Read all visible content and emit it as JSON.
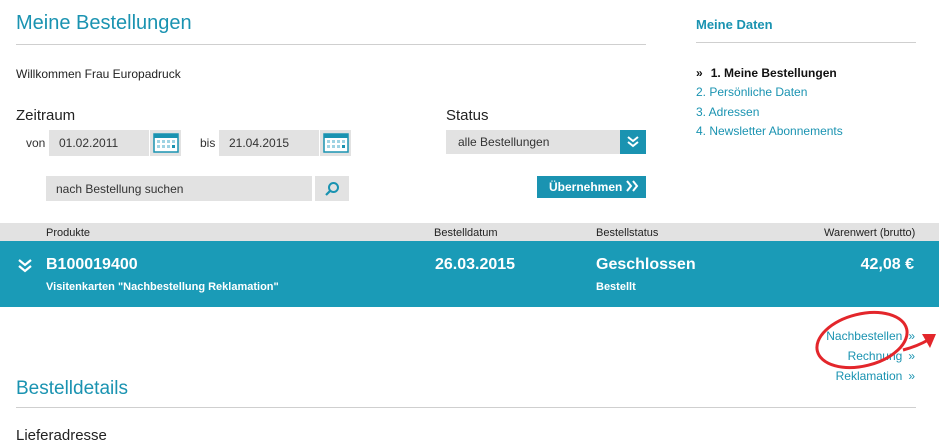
{
  "page_title": "Meine Bestellungen",
  "welcome_text": "Willkommen Frau Europadruck",
  "filter": {
    "period_label": "Zeitraum",
    "from_label": "von",
    "from_value": "01.02.2011",
    "to_label": "bis",
    "to_value": "21.04.2015",
    "status_label": "Status",
    "status_value": "alle Bestellungen",
    "search_placeholder": "nach Bestellung suchen",
    "submit_label": "Übernehmen"
  },
  "sidebar": {
    "title": "Meine Daten",
    "items": [
      {
        "label": "1. Meine Bestellungen",
        "active": true
      },
      {
        "label": "2. Persönliche Daten",
        "active": false
      },
      {
        "label": "3. Adressen",
        "active": false
      },
      {
        "label": "4. Newsletter Abonnements",
        "active": false
      }
    ]
  },
  "table": {
    "headers": {
      "products": "Produkte",
      "date": "Bestelldatum",
      "status": "Bestellstatus",
      "value": "Warenwert (brutto)"
    },
    "order": {
      "number": "B100019400",
      "product": "Visitenkarten \"Nachbestellung Reklamation\"",
      "date": "26.03.2015",
      "status": "Geschlossen",
      "substatus": "Bestellt",
      "value": "42,08 €"
    }
  },
  "actions": {
    "reorder": "Nachbestellen",
    "invoice": "Rechnung",
    "complaint": "Reklamation"
  },
  "details_title": "Bestelldetails",
  "delivery_title": "Lieferadresse",
  "colors": {
    "accent": "#1a93b1",
    "order_row": "#1a9bb7",
    "field_bg": "#e2e2e2",
    "annotation": "#e3262b"
  }
}
